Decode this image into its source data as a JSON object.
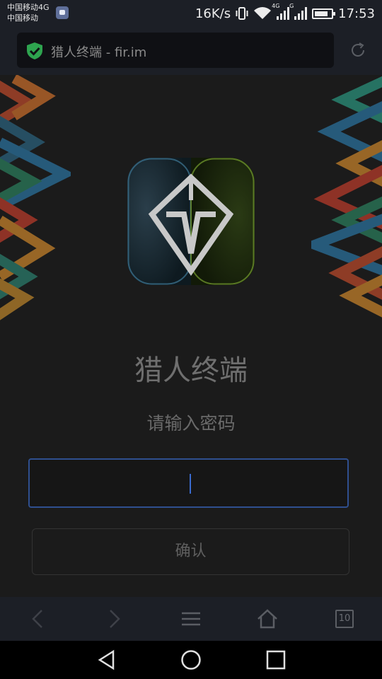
{
  "status_bar": {
    "carrier_line1": "中国移动4G",
    "carrier_line2": "中国移动",
    "speed": "16K/s",
    "net_4g": "4G",
    "net_g": "G",
    "time": "17:53",
    "battery_level": 0.85
  },
  "browser": {
    "url_text": "猎人终端 - fir.im",
    "secure_icon": "shield-check-icon",
    "reload_icon": "reload-icon",
    "tab_count": "10"
  },
  "page": {
    "app_title": "猎人终端",
    "prompt": "请输入密码",
    "password_value": "",
    "confirm_label": "确认"
  },
  "toolbar": {
    "back_icon": "back-arrow-icon",
    "forward_icon": "forward-arrow-icon",
    "menu_icon": "menu-icon",
    "home_icon": "home-icon"
  },
  "colors": {
    "background": "#1b1b1b",
    "bar": "#1c1f26",
    "input_border": "#2f4f8f",
    "secure_green": "#2ea44f"
  }
}
